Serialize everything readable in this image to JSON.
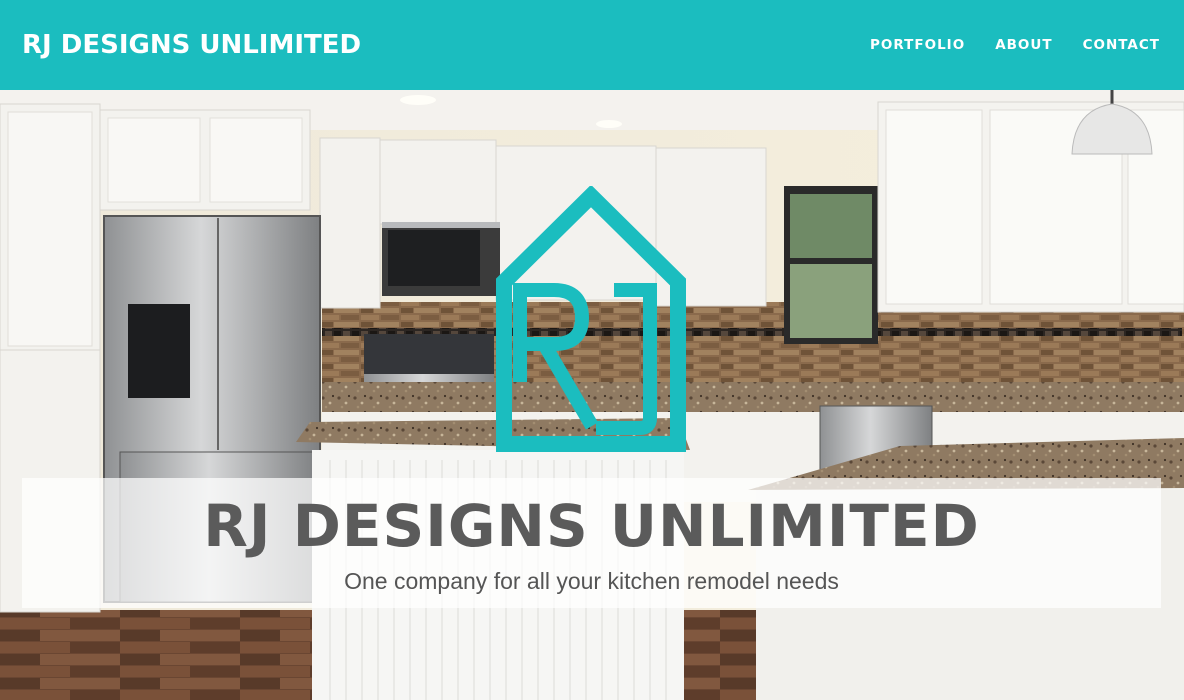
{
  "nav": {
    "brand": "RJ DESIGNS UNLIMITED",
    "links": [
      "PORTFOLIO",
      "ABOUT",
      "CONTACT"
    ]
  },
  "hero": {
    "title": "RJ DESIGNS UNLIMITED",
    "subtitle": "One company for all your kitchen remodel needs",
    "logo_icon": "rj-house-logo-icon"
  },
  "colors": {
    "brand_teal": "#1bbdbf",
    "caption_text": "#5b5b5b"
  }
}
